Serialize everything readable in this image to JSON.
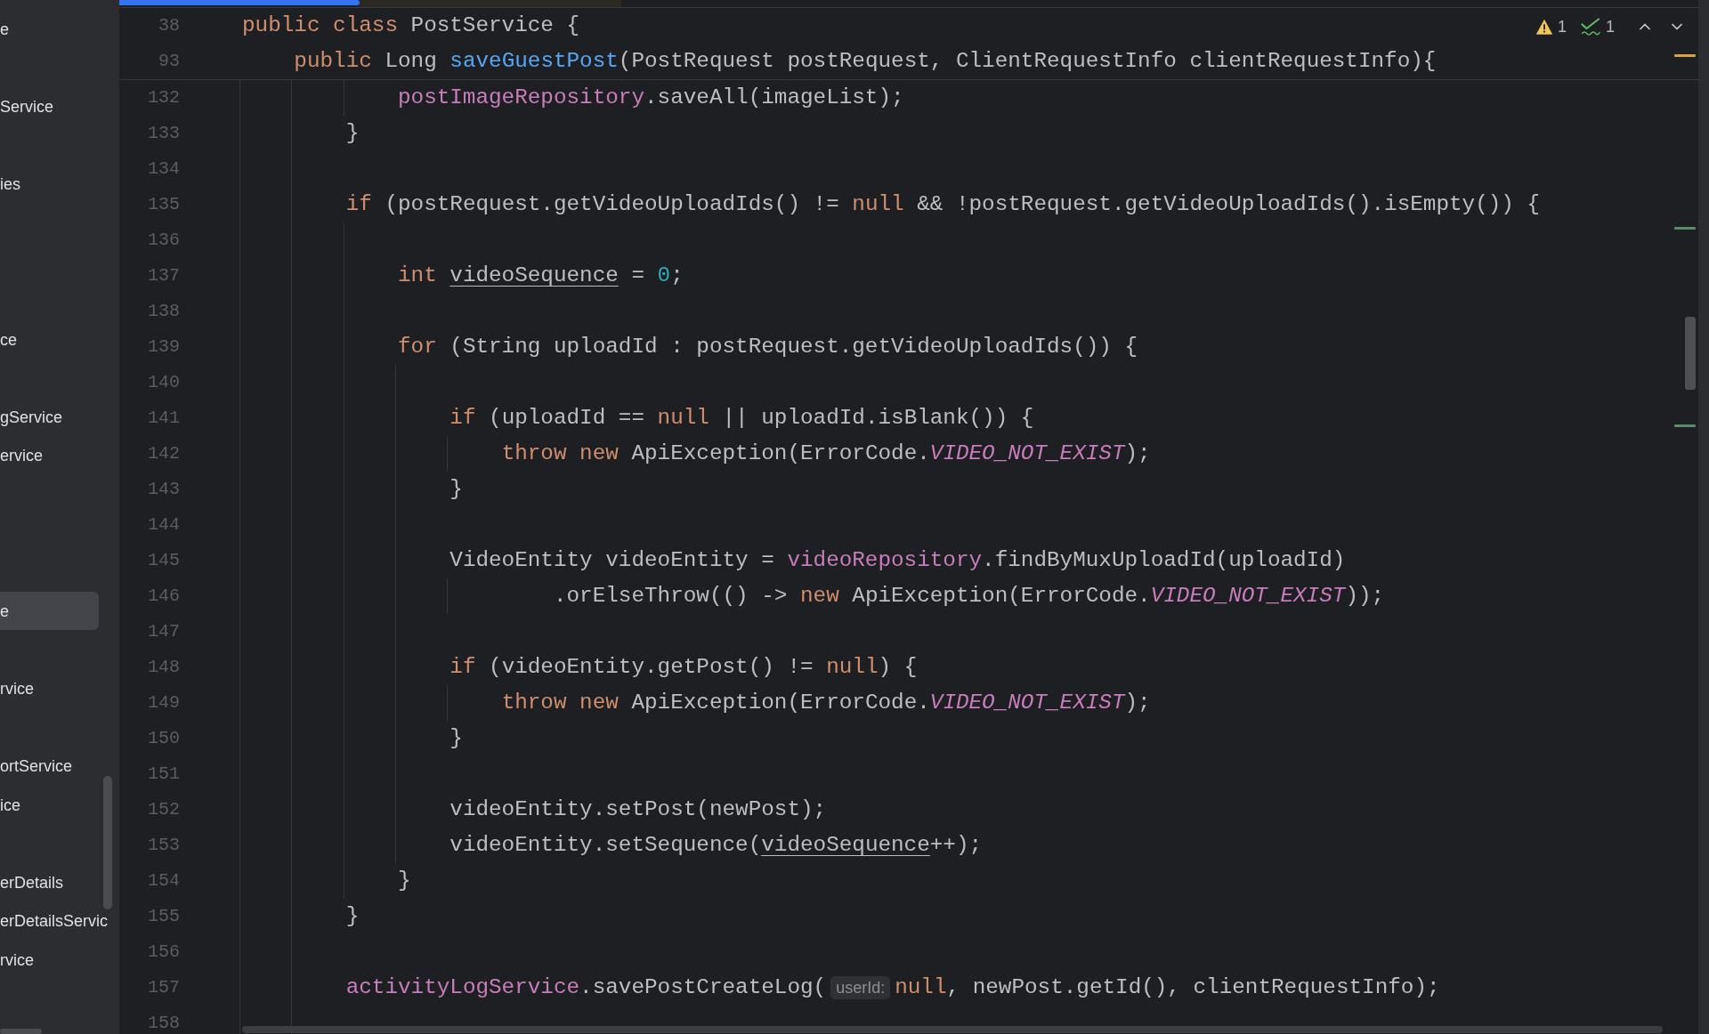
{
  "sidebar": {
    "items": [
      {
        "label": "e",
        "selected": false
      },
      {
        "label": "Service",
        "selected": false
      },
      {
        "label": "ies",
        "selected": false
      },
      {
        "label": "ce",
        "selected": false
      },
      {
        "label": "gService",
        "selected": false
      },
      {
        "label": "ervice",
        "selected": false
      },
      {
        "label": "e",
        "selected": true
      },
      {
        "label": "rvice",
        "selected": false
      },
      {
        "label": "ortService",
        "selected": false
      },
      {
        "label": "ice",
        "selected": false
      },
      {
        "label": "erDetails",
        "selected": false
      },
      {
        "label": "erDetailsServic",
        "selected": false
      },
      {
        "label": "rvice",
        "selected": false
      }
    ]
  },
  "editor": {
    "inspections": [
      {
        "kind": "warning",
        "count": "1"
      },
      {
        "kind": "typo",
        "count": "1"
      }
    ],
    "error_stripe": [
      {
        "color": "#d9a343"
      },
      {
        "color": "#5b8c6a"
      },
      {
        "color": "#5b8c6a"
      }
    ],
    "sticky_lines": [
      {
        "number": "38",
        "tokens": [
          {
            "text": "public class ",
            "kind": "keyword"
          },
          {
            "text": "PostService {",
            "kind": "plain"
          }
        ]
      },
      {
        "number": "93",
        "tokens": [
          {
            "text": "    public ",
            "kind": "keyword"
          },
          {
            "text": "Long ",
            "kind": "plain"
          },
          {
            "text": "saveGuestPost",
            "kind": "declaration"
          },
          {
            "text": "(PostRequest postRequest, ClientRequestInfo clientRequestInfo){",
            "kind": "plain"
          }
        ]
      }
    ],
    "lines": [
      {
        "number": "132",
        "tokens": [
          {
            "text": "            postImageRepository",
            "kind": "field"
          },
          {
            "text": ".saveAll(imageList);",
            "kind": "plain"
          }
        ]
      },
      {
        "number": "133",
        "tokens": [
          {
            "text": "        }",
            "kind": "plain"
          }
        ]
      },
      {
        "number": "134"
      },
      {
        "number": "135",
        "tokens": [
          {
            "text": "        if ",
            "kind": "keyword"
          },
          {
            "text": "(postRequest.getVideoUploadIds() != ",
            "kind": "plain"
          },
          {
            "text": "null",
            "kind": "keyword"
          },
          {
            "text": " && !postRequest.getVideoUploadIds().isEmpty()) {",
            "kind": "plain"
          }
        ]
      },
      {
        "number": "136"
      },
      {
        "number": "137",
        "tokens": [
          {
            "text": "            int ",
            "kind": "keyword"
          },
          {
            "text": "videoSequence",
            "kind": "reassigned"
          },
          {
            "text": " = ",
            "kind": "plain"
          },
          {
            "text": "0",
            "kind": "number"
          },
          {
            "text": ";",
            "kind": "plain"
          }
        ]
      },
      {
        "number": "138"
      },
      {
        "number": "139",
        "tokens": [
          {
            "text": "            for ",
            "kind": "keyword"
          },
          {
            "text": "(String uploadId : postRequest.getVideoUploadIds()) {",
            "kind": "plain"
          }
        ]
      },
      {
        "number": "140"
      },
      {
        "number": "141",
        "tokens": [
          {
            "text": "                if ",
            "kind": "keyword"
          },
          {
            "text": "(uploadId == ",
            "kind": "plain"
          },
          {
            "text": "null",
            "kind": "keyword"
          },
          {
            "text": " || uploadId.isBlank()) {",
            "kind": "plain"
          }
        ]
      },
      {
        "number": "142",
        "tokens": [
          {
            "text": "                    throw new ",
            "kind": "keyword"
          },
          {
            "text": "ApiException(ErrorCode.",
            "kind": "plain"
          },
          {
            "text": "VIDEO_NOT_EXIST",
            "kind": "constant"
          },
          {
            "text": ");",
            "kind": "plain"
          }
        ]
      },
      {
        "number": "143",
        "tokens": [
          {
            "text": "                }",
            "kind": "plain"
          }
        ]
      },
      {
        "number": "144"
      },
      {
        "number": "145",
        "tokens": [
          {
            "text": "                VideoEntity videoEntity = ",
            "kind": "plain"
          },
          {
            "text": "videoRepository",
            "kind": "field"
          },
          {
            "text": ".findByMuxUploadId(uploadId)",
            "kind": "plain"
          }
        ]
      },
      {
        "number": "146",
        "tokens": [
          {
            "text": "                        .orElseThrow(() -> ",
            "kind": "plain"
          },
          {
            "text": "new ",
            "kind": "keyword"
          },
          {
            "text": "ApiException(ErrorCode.",
            "kind": "plain"
          },
          {
            "text": "VIDEO_NOT_EXIST",
            "kind": "constant"
          },
          {
            "text": "));",
            "kind": "plain"
          }
        ]
      },
      {
        "number": "147"
      },
      {
        "number": "148",
        "tokens": [
          {
            "text": "                if ",
            "kind": "keyword"
          },
          {
            "text": "(videoEntity.getPost() != ",
            "kind": "plain"
          },
          {
            "text": "null",
            "kind": "keyword"
          },
          {
            "text": ") {",
            "kind": "plain"
          }
        ]
      },
      {
        "number": "149",
        "tokens": [
          {
            "text": "                    throw new ",
            "kind": "keyword"
          },
          {
            "text": "ApiException(ErrorCode.",
            "kind": "plain"
          },
          {
            "text": "VIDEO_NOT_EXIST",
            "kind": "constant"
          },
          {
            "text": ");",
            "kind": "plain"
          }
        ]
      },
      {
        "number": "150",
        "tokens": [
          {
            "text": "                }",
            "kind": "plain"
          }
        ]
      },
      {
        "number": "151"
      },
      {
        "number": "152",
        "tokens": [
          {
            "text": "                videoEntity.setPost(newPost);",
            "kind": "plain"
          }
        ]
      },
      {
        "number": "153",
        "tokens": [
          {
            "text": "                videoEntity.setSequence(",
            "kind": "plain"
          },
          {
            "text": "videoSequence",
            "kind": "reassigned"
          },
          {
            "text": "++);",
            "kind": "plain"
          }
        ]
      },
      {
        "number": "154",
        "tokens": [
          {
            "text": "            }",
            "kind": "plain"
          }
        ]
      },
      {
        "number": "155",
        "tokens": [
          {
            "text": "        }",
            "kind": "plain"
          }
        ]
      },
      {
        "number": "156"
      },
      {
        "number": "157",
        "tokens": [
          {
            "text": "        activityLogService",
            "kind": "field"
          },
          {
            "text": ".savePostCreateLog(",
            "kind": "plain"
          },
          {
            "text": "userId:",
            "kind": "hint"
          },
          {
            "text": "null",
            "kind": "keyword"
          },
          {
            "text": ", newPost.getId(), clientRequestInfo);",
            "kind": "plain"
          }
        ]
      },
      {
        "number": "158"
      }
    ]
  }
}
